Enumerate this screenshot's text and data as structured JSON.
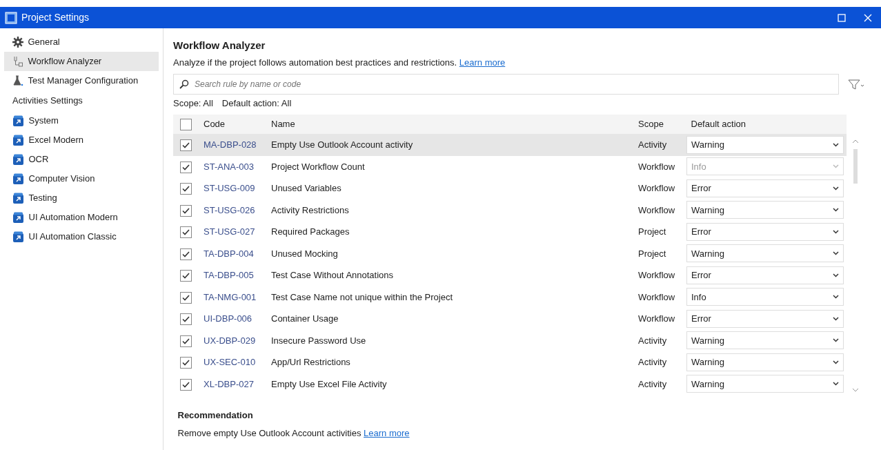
{
  "window": {
    "title": "Project Settings"
  },
  "sidebar": {
    "items": [
      {
        "kind": "general",
        "label": "General",
        "selected": false
      },
      {
        "kind": "analyzer",
        "label": "Workflow Analyzer",
        "selected": true
      },
      {
        "kind": "testmanager",
        "label": "Test Manager Configuration",
        "selected": false
      },
      {
        "kind": "section",
        "label": "Activities Settings"
      },
      {
        "kind": "package",
        "label": "System",
        "selected": false
      },
      {
        "kind": "package",
        "label": "Excel Modern",
        "selected": false
      },
      {
        "kind": "package",
        "label": "OCR",
        "selected": false
      },
      {
        "kind": "package",
        "label": "Computer Vision",
        "selected": false
      },
      {
        "kind": "package",
        "label": "Testing",
        "selected": false
      },
      {
        "kind": "package",
        "label": "UI Automation Modern",
        "selected": false
      },
      {
        "kind": "package",
        "label": "UI Automation Classic",
        "selected": false
      }
    ]
  },
  "main": {
    "title": "Workflow Analyzer",
    "description": "Analyze if the project follows automation best practices and restrictions.",
    "description_link": "Learn more",
    "search": {
      "placeholder": "Search rule by name or code"
    },
    "filters": [
      "Scope: All",
      "Default action: All"
    ],
    "table": {
      "all_checked": false,
      "columns": [
        "Code",
        "Name",
        "Scope",
        "Default action"
      ],
      "rows": [
        {
          "checked": true,
          "selected": true,
          "code": "MA-DBP-028",
          "name": "Empty Use Outlook Account activity",
          "scope": "Activity",
          "action": "Warning",
          "disabled": false
        },
        {
          "checked": true,
          "selected": false,
          "code": "ST-ANA-003",
          "name": "Project Workflow Count",
          "scope": "Workflow",
          "action": "Info",
          "disabled": true
        },
        {
          "checked": true,
          "selected": false,
          "code": "ST-USG-009",
          "name": "Unused Variables",
          "scope": "Workflow",
          "action": "Error",
          "disabled": false
        },
        {
          "checked": true,
          "selected": false,
          "code": "ST-USG-026",
          "name": "Activity Restrictions",
          "scope": "Workflow",
          "action": "Warning",
          "disabled": false
        },
        {
          "checked": true,
          "selected": false,
          "code": "ST-USG-027",
          "name": "Required Packages",
          "scope": "Project",
          "action": "Error",
          "disabled": false
        },
        {
          "checked": true,
          "selected": false,
          "code": "TA-DBP-004",
          "name": "Unused Mocking",
          "scope": "Project",
          "action": "Warning",
          "disabled": false
        },
        {
          "checked": true,
          "selected": false,
          "code": "TA-DBP-005",
          "name": "Test Case Without Annotations",
          "scope": "Workflow",
          "action": "Error",
          "disabled": false
        },
        {
          "checked": true,
          "selected": false,
          "code": "TA-NMG-001",
          "name": "Test Case Name not unique within the Project",
          "scope": "Workflow",
          "action": "Info",
          "disabled": false
        },
        {
          "checked": true,
          "selected": false,
          "code": "UI-DBP-006",
          "name": "Container Usage",
          "scope": "Workflow",
          "action": "Error",
          "disabled": false
        },
        {
          "checked": true,
          "selected": false,
          "code": "UX-DBP-029",
          "name": "Insecure Password Use",
          "scope": "Activity",
          "action": "Warning",
          "disabled": false
        },
        {
          "checked": true,
          "selected": false,
          "code": "UX-SEC-010",
          "name": "App/Url Restrictions",
          "scope": "Activity",
          "action": "Warning",
          "disabled": false
        },
        {
          "checked": true,
          "selected": false,
          "code": "XL-DBP-027",
          "name": "Empty Use Excel File Activity",
          "scope": "Activity",
          "action": "Warning",
          "disabled": false
        }
      ]
    },
    "recommendation": {
      "title": "Recommendation",
      "text": "Remove empty Use Outlook Account activities",
      "link": "Learn more"
    }
  }
}
